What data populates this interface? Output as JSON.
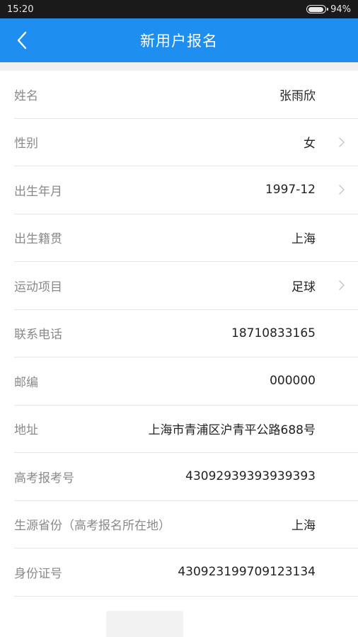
{
  "status_bar": {
    "time": "15:20",
    "battery_percent": "94%",
    "battery_level": 0.94
  },
  "header": {
    "title": "新用户报名",
    "background_color": "#1f8ef1"
  },
  "form": {
    "rows": [
      {
        "label": "姓名",
        "value": "张雨欣",
        "has_chevron": false
      },
      {
        "label": "性别",
        "value": "女",
        "has_chevron": true
      },
      {
        "label": "出生年月",
        "value": "1997-12",
        "has_chevron": true
      },
      {
        "label": "出生籍贯",
        "value": "上海",
        "has_chevron": false
      },
      {
        "label": "运动项目",
        "value": "足球",
        "has_chevron": true
      },
      {
        "label": "联系电话",
        "value": "18710833165",
        "has_chevron": false
      },
      {
        "label": "邮编",
        "value": "000000",
        "has_chevron": false
      },
      {
        "label": "地址",
        "value": "上海市青浦区沪青平公路688号",
        "has_chevron": false
      },
      {
        "label": "高考报考号",
        "value": "43092939393939393",
        "has_chevron": false
      },
      {
        "label": "生源省份（高考报名所在地）",
        "value": "上海",
        "has_chevron": false
      },
      {
        "label": "身份证号",
        "value": "430923199709123134",
        "has_chevron": false
      }
    ]
  },
  "icons": {
    "back": "chevron-left-icon",
    "row_arrow": "chevron-right-icon",
    "battery": "battery-icon"
  }
}
